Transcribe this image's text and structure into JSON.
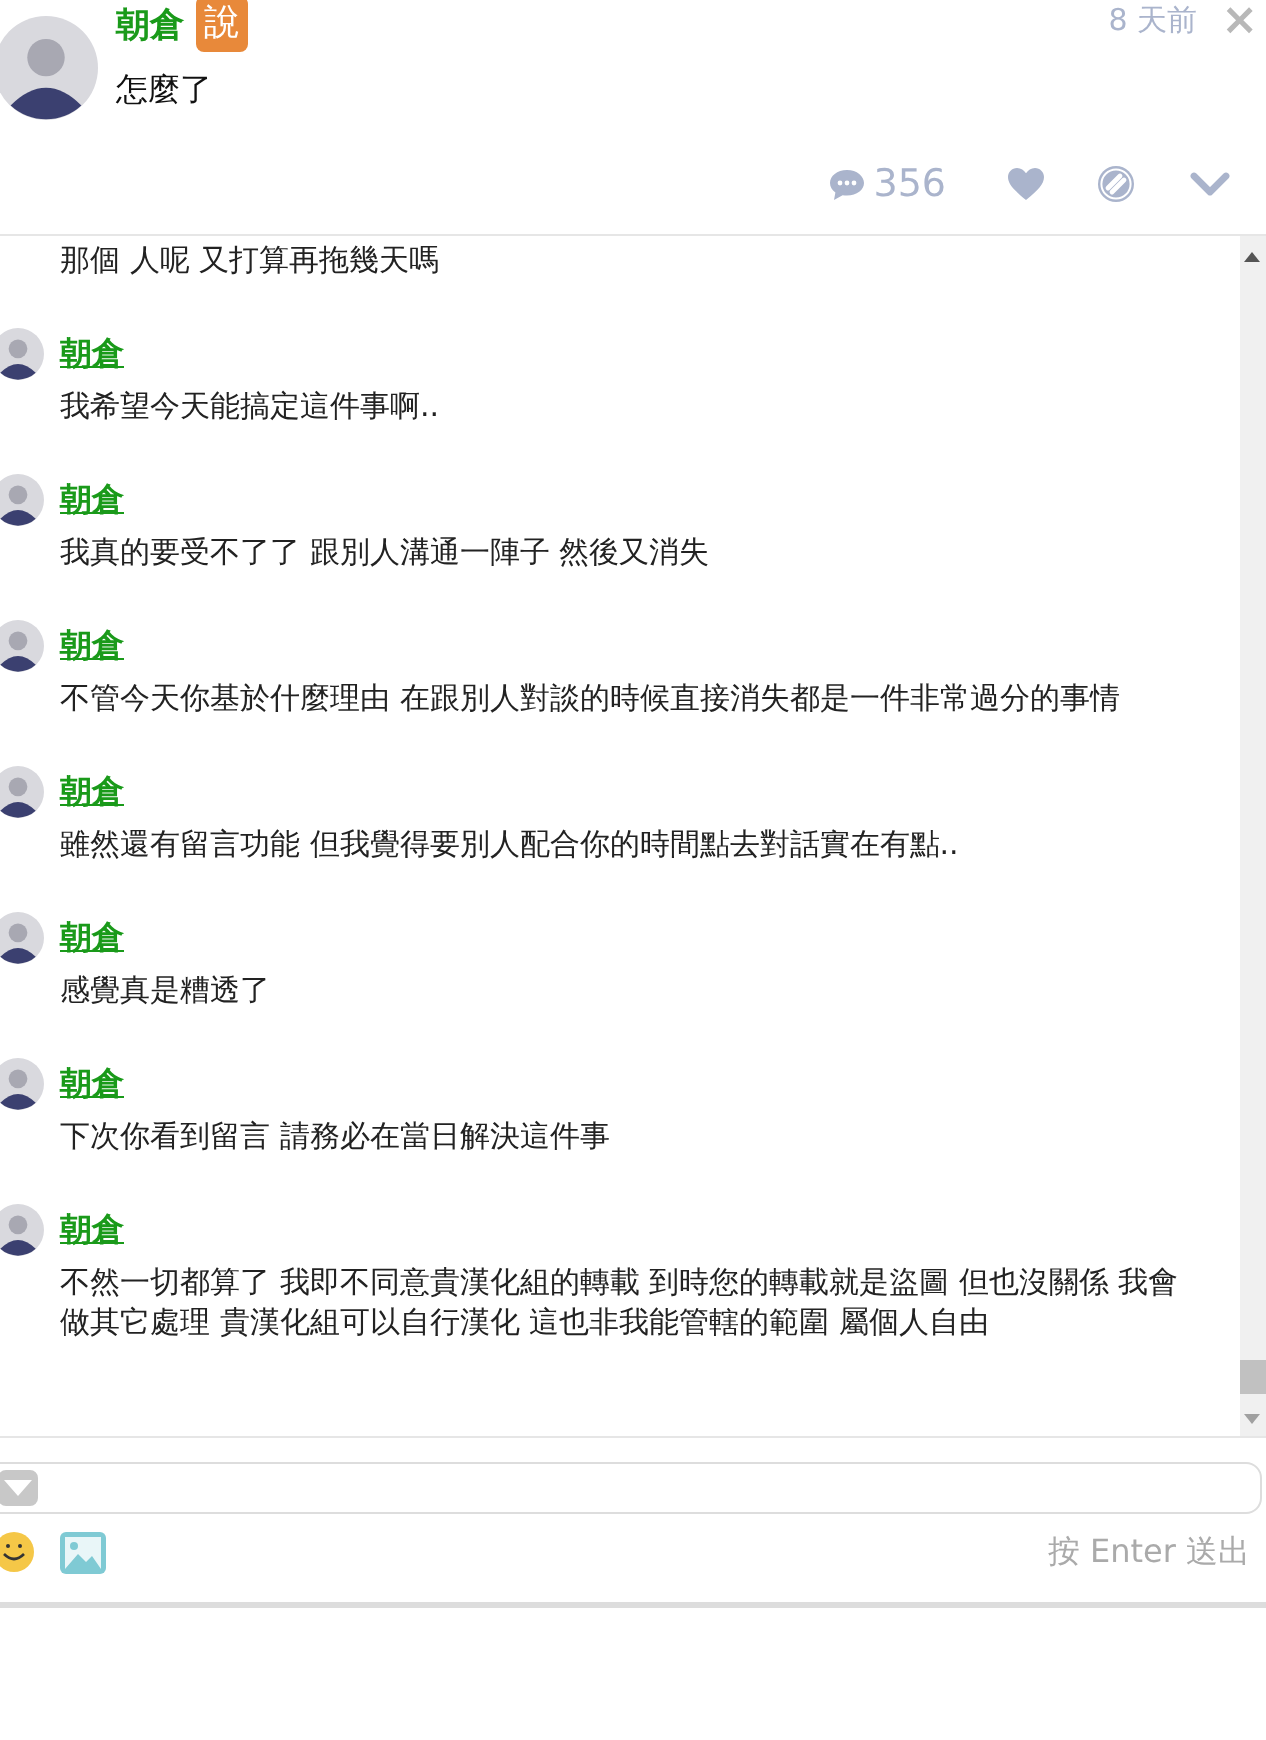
{
  "post": {
    "author": "朝倉",
    "badge": "說",
    "text": "怎麼了",
    "time": "8 天前",
    "close": "×",
    "comment_count": "356"
  },
  "comments": [
    {
      "text": "那個 人呢 又打算再拖幾天嗎"
    },
    {
      "author": "朝倉",
      "text": "我希望今天能搞定這件事啊.."
    },
    {
      "author": "朝倉",
      "text": "我真的要受不了了 跟別人溝通一陣子 然後又消失"
    },
    {
      "author": "朝倉",
      "text": "不管今天你基於什麼理由 在跟別人對談的時候直接消失都是一件非常過分的事情"
    },
    {
      "author": "朝倉",
      "text": "雖然還有留言功能 但我覺得要別人配合你的時間點去對話實在有點.."
    },
    {
      "author": "朝倉",
      "text": "感覺真是糟透了"
    },
    {
      "author": "朝倉",
      "text": "下次你看到留言 請務必在當日解決這件事"
    },
    {
      "author": "朝倉",
      "text": "不然一切都算了 我即不同意貴漢化組的轉載 到時您的轉載就是盜圖 但也沒關係 我會做其它處理 貴漢化組可以自行漢化 這也非我能管轄的範圍 屬個人自由"
    }
  ],
  "reply": {
    "hint": "按 Enter 送出"
  }
}
